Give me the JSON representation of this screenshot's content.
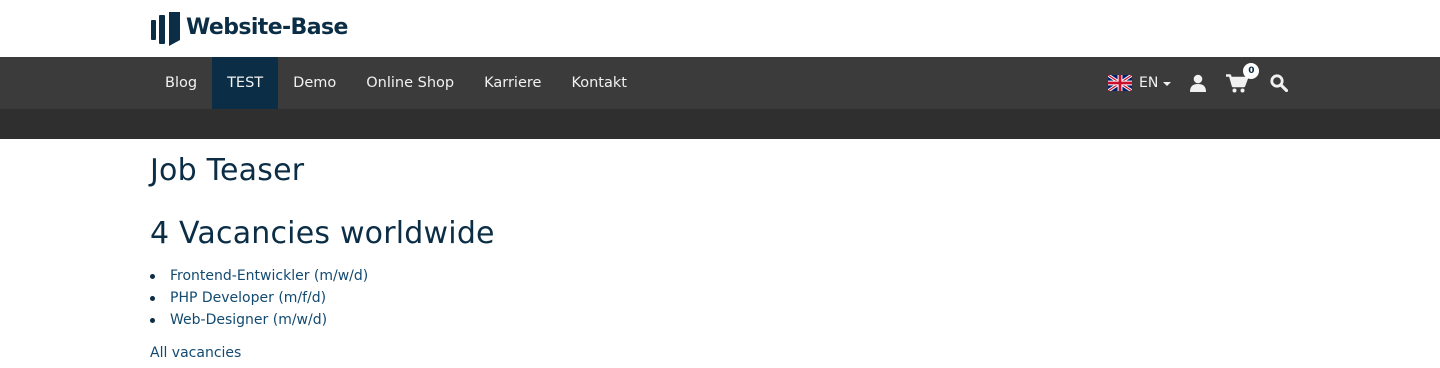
{
  "brand": {
    "name": "Website-Base",
    "logo_icon": "brand-bars-icon",
    "color": "#0b2d45"
  },
  "nav": {
    "items": [
      {
        "label": "Blog",
        "active": false
      },
      {
        "label": "TEST",
        "active": true
      },
      {
        "label": "Demo",
        "active": false
      },
      {
        "label": "Online Shop",
        "active": false
      },
      {
        "label": "Karriere",
        "active": false
      },
      {
        "label": "Kontakt",
        "active": false
      }
    ],
    "language": {
      "code": "EN",
      "flag_icon": "uk-flag-icon"
    },
    "user_icon": "user-icon",
    "cart": {
      "icon": "cart-icon",
      "count": "0"
    },
    "search_icon": "search-icon"
  },
  "main": {
    "title": "Job Teaser",
    "vacancies_heading": "4 Vacancies worldwide",
    "jobs": [
      {
        "label": "Frontend-Entwickler (m/w/d)"
      },
      {
        "label": "PHP Developer (m/f/d)"
      },
      {
        "label": "Web-Designer (m/w/d)"
      }
    ],
    "all_link": "All vacancies"
  },
  "colors": {
    "navbar": "#3b3b3b",
    "subbar": "#2f2f2f",
    "active_nav": "#0b2d45",
    "link": "#124a70"
  }
}
